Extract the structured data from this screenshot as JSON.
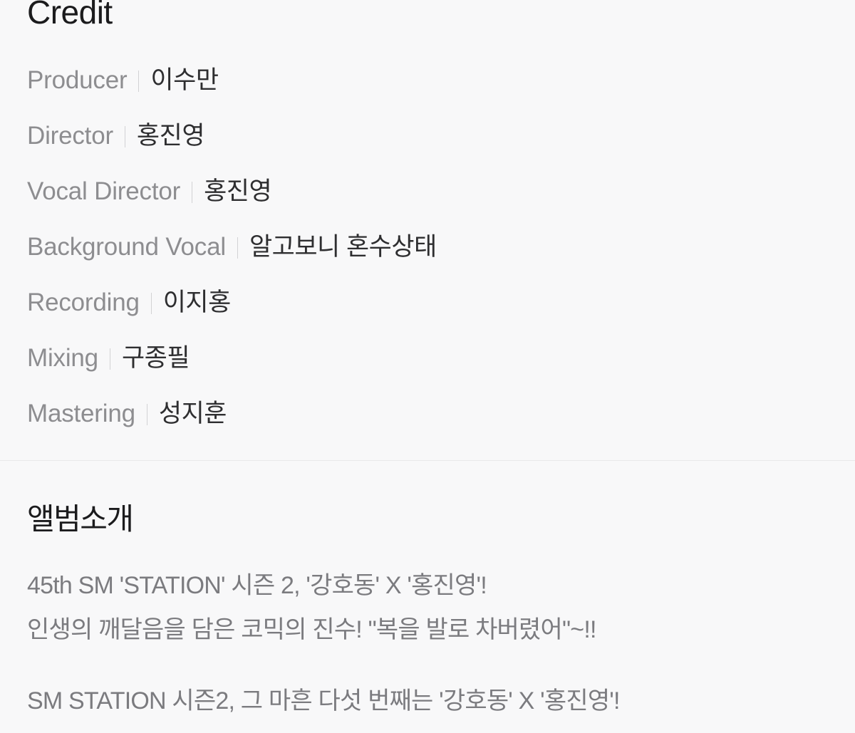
{
  "credit": {
    "heading": "Credit",
    "separator": "|",
    "rows": [
      {
        "label": "Producer",
        "value": "이수만"
      },
      {
        "label": "Director",
        "value": "홍진영"
      },
      {
        "label": "Vocal Director",
        "value": "홍진영"
      },
      {
        "label": "Background Vocal",
        "value": "알고보니 혼수상태"
      },
      {
        "label": "Recording",
        "value": "이지홍"
      },
      {
        "label": "Mixing",
        "value": "구종필"
      },
      {
        "label": "Mastering",
        "value": "성지훈"
      }
    ]
  },
  "album_intro": {
    "heading": "앨범소개",
    "lines": [
      "45th SM 'STATION' 시즌 2, '강호동' X '홍진영'!",
      "인생의 깨달음을 담은 코믹의 진수! \"복을 발로 차버렸어\"~!!",
      "",
      "SM STATION 시즌2, 그 마흔 다섯 번째는 '강호동' X '홍진영'!"
    ]
  },
  "colors": {
    "background": "#f8f8f9",
    "heading_text": "#1b1b1d",
    "label_text": "#8d8d90",
    "value_text": "#2e2e30",
    "body_text": "#7b7b7f",
    "divider": "#e8e8ea",
    "separator_bar": "#d2d2d4"
  }
}
